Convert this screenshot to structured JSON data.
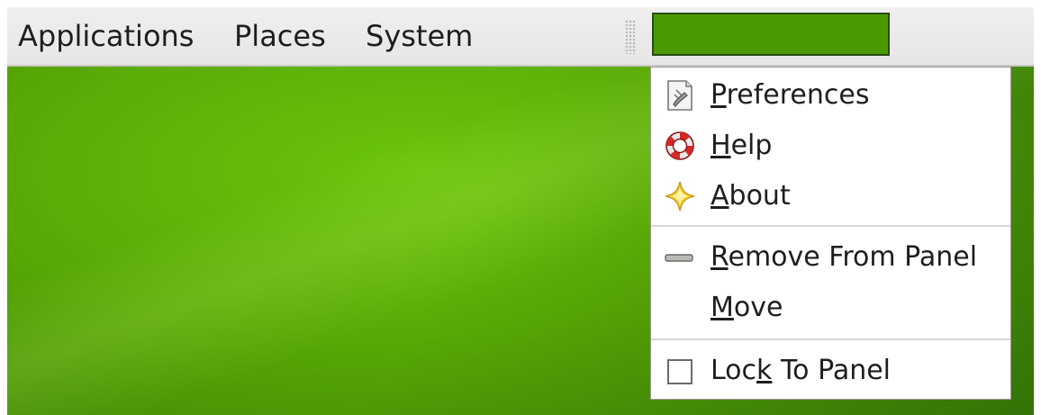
{
  "panel": {
    "menus": [
      {
        "label": "Applications"
      },
      {
        "label": "Places"
      },
      {
        "label": "System"
      }
    ],
    "applet_color": "#4b9a04"
  },
  "context_menu": {
    "items": [
      {
        "label": "Preferences",
        "mnemonic": "P",
        "icon": "preferences-icon"
      },
      {
        "label": "Help",
        "mnemonic": "H",
        "icon": "help-lifebuoy-icon"
      },
      {
        "label": "About",
        "mnemonic": "A",
        "icon": "about-star-icon"
      },
      {
        "label": "Remove From Panel",
        "mnemonic": "R",
        "icon": "remove-icon"
      },
      {
        "label": "Move",
        "mnemonic": "M",
        "icon": ""
      },
      {
        "label": "Lock To Panel",
        "mnemonic": "k",
        "icon": "checkbox-icon",
        "checked": false
      }
    ]
  },
  "colors": {
    "desktop_green": "#5aab06",
    "panel_bg": "#ebeae8"
  }
}
